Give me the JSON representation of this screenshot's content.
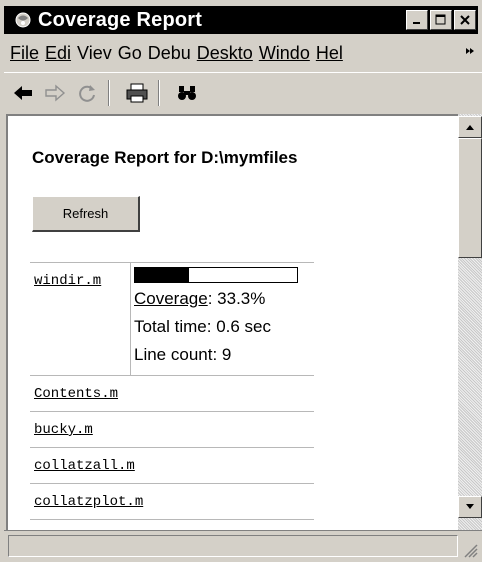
{
  "window": {
    "title": "Coverage Report",
    "menu": {
      "items": [
        {
          "key": "F",
          "rest": "ile"
        },
        {
          "key": "E",
          "rest": "di"
        },
        {
          "key": "",
          "rest": "Viev"
        },
        {
          "key": "",
          "rest": "Go"
        },
        {
          "key": "",
          "rest": "De",
          "key2": "b",
          "rest2": "u"
        },
        {
          "key": "D",
          "rest": "eskto"
        },
        {
          "key": "W",
          "rest": "indo"
        },
        {
          "key": "H",
          "rest": "el"
        }
      ],
      "labels": [
        "File",
        "Edi",
        "Viev",
        "Go",
        "Debu",
        "Deskto",
        "Windo",
        "Hel"
      ],
      "overflow_icon": "chevron-right-icon"
    },
    "toolbar": {
      "icons": [
        "back-arrow-icon",
        "forward-arrow-icon",
        "refresh-icon",
        "print-icon",
        "find-icon"
      ]
    }
  },
  "report": {
    "heading": "Coverage Report for D:\\mymfiles",
    "refresh_label": "Refresh",
    "files": [
      {
        "name": "windir.m",
        "coverage_fraction": 0.333,
        "coverage_label": "Coverage",
        "coverage_value": ": 33.3%",
        "total_time": "Total time: 0.6 sec",
        "line_count": "Line count: 9"
      },
      {
        "name": "Contents.m"
      },
      {
        "name": "bucky.m"
      },
      {
        "name": "collatzall.m"
      },
      {
        "name": "collatzplot.m"
      }
    ]
  },
  "colors": {
    "chrome": "#d4d0c8",
    "titlebar": "#000000",
    "bar_fill": "#000000"
  }
}
